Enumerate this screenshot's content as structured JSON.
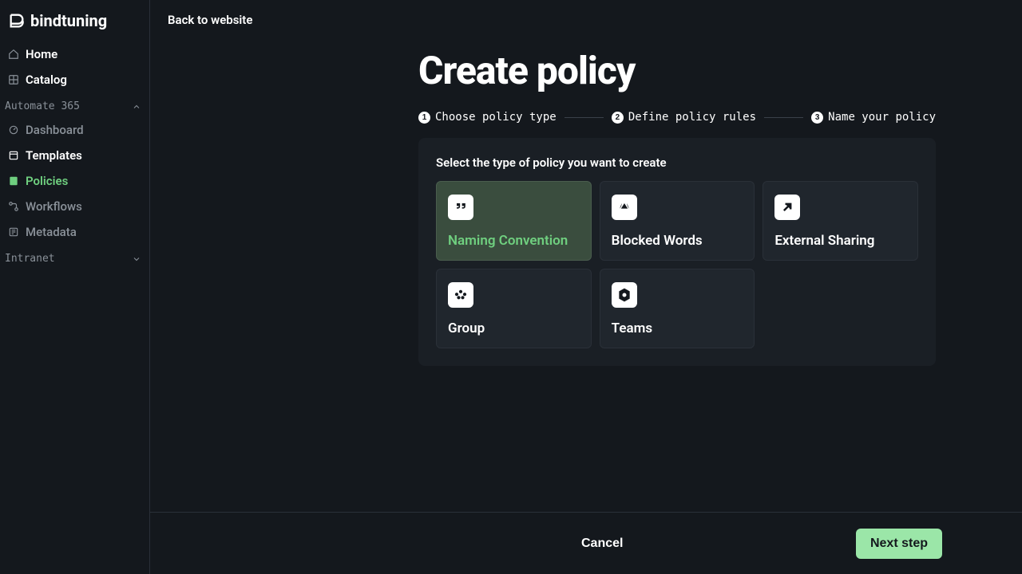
{
  "brand": "bindtuning",
  "topbar": {
    "back": "Back to website"
  },
  "sidebar": {
    "home": "Home",
    "catalog": "Catalog",
    "section_automate": "Automate 365",
    "items_automate": [
      {
        "label": "Dashboard"
      },
      {
        "label": "Templates"
      },
      {
        "label": "Policies"
      },
      {
        "label": "Workflows"
      },
      {
        "label": "Metadata"
      }
    ],
    "section_intranet": "Intranet"
  },
  "page": {
    "title": "Create policy",
    "steps": [
      "Choose policy type",
      "Define policy rules",
      "Name your policy"
    ],
    "panel_title": "Select the type of policy you want to create",
    "cards": [
      {
        "label": "Naming Convention",
        "selected": true
      },
      {
        "label": "Blocked Words",
        "selected": false
      },
      {
        "label": "External Sharing",
        "selected": false
      },
      {
        "label": "Group",
        "selected": false
      },
      {
        "label": "Teams",
        "selected": false
      }
    ]
  },
  "footer": {
    "cancel": "Cancel",
    "next": "Next step"
  }
}
